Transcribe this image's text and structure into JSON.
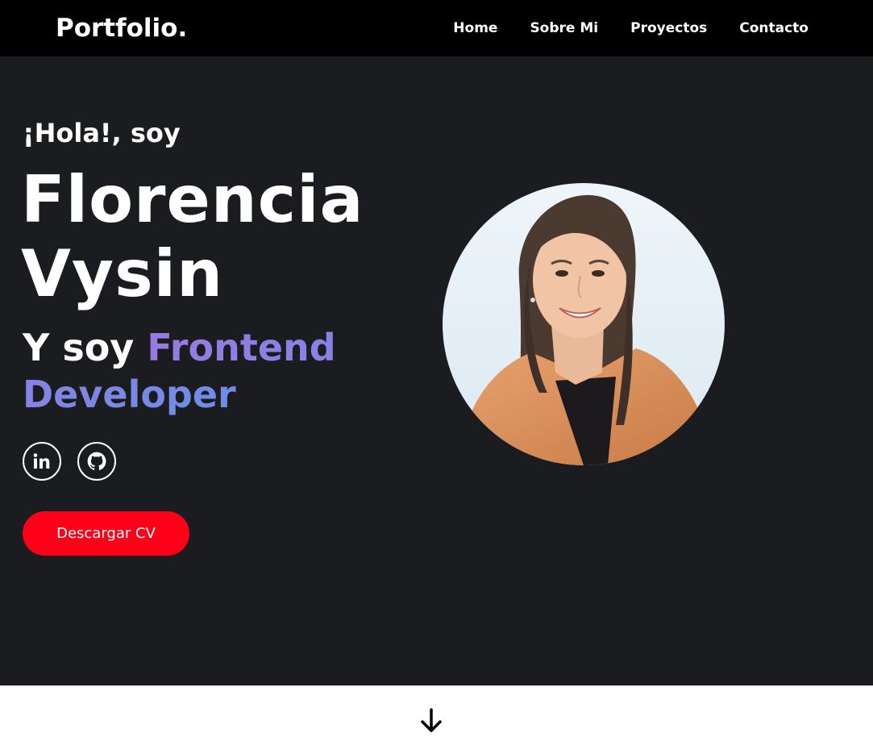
{
  "header": {
    "logo": "Portfolio.",
    "nav": [
      {
        "label": "Home"
      },
      {
        "label": "Sobre Mi"
      },
      {
        "label": "Proyectos"
      },
      {
        "label": "Contacto"
      }
    ]
  },
  "hero": {
    "greeting": "¡Hola!, soy",
    "name_line1": "Florencia",
    "name_line2": "Vysin",
    "role_prefix": "Y soy ",
    "role_accent": "Frontend Developer",
    "socials": [
      {
        "icon": "linkedin-icon"
      },
      {
        "icon": "github-icon"
      }
    ],
    "cv_button": "Descargar CV",
    "avatar_icon": "profile-photo"
  },
  "footer": {
    "icon": "arrow-down-icon"
  },
  "colors": {
    "nav_bg": "#000000",
    "hero_bg": "#1b1c1f",
    "accent_start": "#9b79e0",
    "accent_end": "#6d8ee6",
    "cv_button": "#ff0018"
  }
}
